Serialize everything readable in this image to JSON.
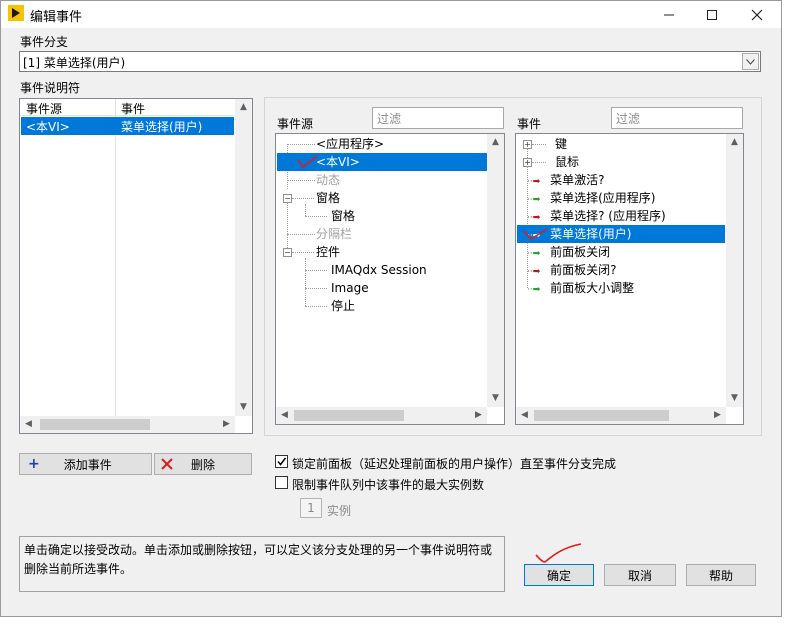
{
  "window": {
    "title": "编辑事件"
  },
  "icons": {
    "app": "labview-icon",
    "minimize": "minimize-icon",
    "maximize": "maximize-icon",
    "close": "close-icon"
  },
  "event_case": {
    "label": "事件分支",
    "selected": "[1] 菜单选择(用户)"
  },
  "specifiers": {
    "label": "事件说明符",
    "columns": [
      "事件源",
      "事件"
    ],
    "rows": [
      {
        "source": "<本VI>",
        "event": "菜单选择(用户)",
        "selected": true
      }
    ]
  },
  "sources": {
    "label": "事件源",
    "filter_placeholder": "过滤",
    "items": [
      {
        "text": "<应用程序>",
        "dim": false
      },
      {
        "text": "<本VI>",
        "dim": false,
        "selected": true
      },
      {
        "text": "动态",
        "dim": true
      },
      {
        "text": "窗格",
        "dim": false
      },
      {
        "text": "窗格",
        "dim": false
      },
      {
        "text": "分隔栏",
        "dim": true
      },
      {
        "text": "控件",
        "dim": false
      },
      {
        "text": "IMAQdx Session",
        "dim": false
      },
      {
        "text": "Image",
        "dim": false
      },
      {
        "text": "停止",
        "dim": false
      }
    ]
  },
  "events": {
    "label": "事件",
    "filter_placeholder": "过滤",
    "items": [
      {
        "text": "键",
        "kind": "group"
      },
      {
        "text": "鼠标",
        "kind": "group"
      },
      {
        "text": "菜单激活?",
        "kind": "filter"
      },
      {
        "text": "菜单选择(应用程序)",
        "kind": "notify"
      },
      {
        "text": "菜单选择?  (应用程序)",
        "kind": "filter"
      },
      {
        "text": "菜单选择(用户)",
        "kind": "notify",
        "selected": true
      },
      {
        "text": "前面板关闭",
        "kind": "notify"
      },
      {
        "text": "前面板关闭?",
        "kind": "filter"
      },
      {
        "text": "前面板大小调整",
        "kind": "notify"
      }
    ],
    "colors": {
      "notify": "#2a9d2a",
      "filter": "#c0141b"
    }
  },
  "buttons": {
    "add": "添加事件",
    "delete": "删除",
    "ok": "确定",
    "cancel": "取消",
    "help": "帮助"
  },
  "options": {
    "lock_panel": {
      "label": "锁定前面板（延迟处理前面板的用户操作）直至事件分支完成",
      "checked": true
    },
    "limit_queue": {
      "label": "限制事件队列中该事件的最大实例数",
      "checked": false
    },
    "instances_value": "1",
    "instances_label": "实例"
  },
  "help_text": "单击确定以接受改动。单击添加或删除按钮，可以定义该分支处理的另一个事件说明符或删除当前所选事件。",
  "colors": {
    "selection": "#0078d7",
    "annotation": "#e21b1b"
  }
}
